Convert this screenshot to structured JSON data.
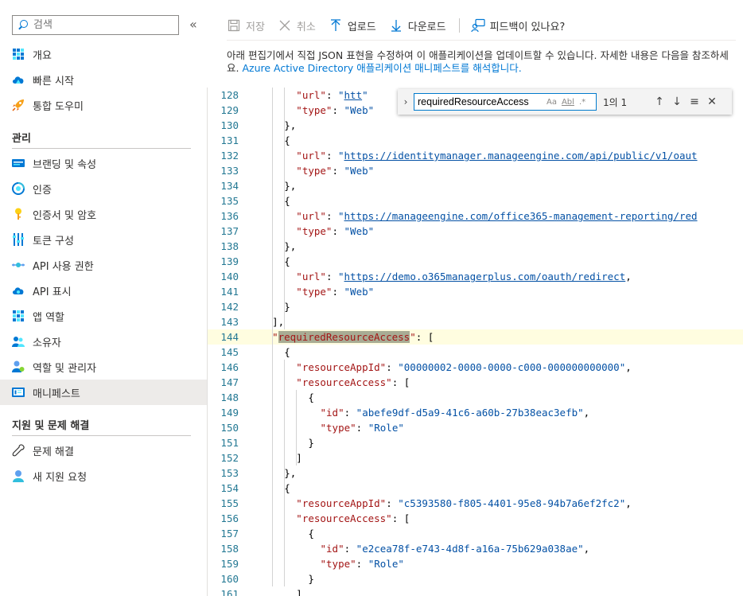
{
  "sidebar": {
    "search_placeholder": "검색",
    "collapse_glyph": "«",
    "items_top": [
      {
        "label": "개요",
        "icon": "grid-icon"
      },
      {
        "label": "빠른 시작",
        "icon": "cloud-icon"
      },
      {
        "label": "통합 도우미",
        "icon": "rocket-icon"
      }
    ],
    "section_manage": "관리",
    "items_manage": [
      {
        "label": "브랜딩 및 속성",
        "icon": "branding-icon"
      },
      {
        "label": "인증",
        "icon": "auth-icon"
      },
      {
        "label": "인증서 및 암호",
        "icon": "key-icon"
      },
      {
        "label": "토큰 구성",
        "icon": "token-icon"
      },
      {
        "label": "API 사용 권한",
        "icon": "api-permission-icon"
      },
      {
        "label": "API 표시",
        "icon": "api-cloud-icon"
      },
      {
        "label": "앱 역할",
        "icon": "app-roles-icon"
      },
      {
        "label": "소유자",
        "icon": "owners-icon"
      },
      {
        "label": "역할 및 관리자",
        "icon": "roles-admins-icon"
      },
      {
        "label": "매니페스트",
        "icon": "manifest-icon",
        "active": true
      }
    ],
    "section_support": "지원 및 문제 해결",
    "items_support": [
      {
        "label": "문제 해결",
        "icon": "wrench-icon"
      },
      {
        "label": "새 지원 요청",
        "icon": "support-icon"
      }
    ]
  },
  "toolbar": {
    "save": "저장",
    "discard": "취소",
    "upload": "업로드",
    "download": "다운로드",
    "feedback": "피드백이 있나요?"
  },
  "description": {
    "text": "아래 편집기에서 직접 JSON 표현을 수정하여 이 애플리케이션을 업데이트할 수 있습니다. 자세한 내용은 다음을 참조하세요.",
    "link": "Azure Active Directory 애플리케이션 매니페스트를 해석합니다."
  },
  "find": {
    "query": "requiredResourceAccess",
    "match_case": "Aa",
    "whole_word": "Abl",
    "regex": ".*",
    "count": "1의 1"
  },
  "editor": {
    "lines": [
      {
        "n": "128",
        "indent": 6,
        "key": "url",
        "val": "htt",
        "url": true,
        "tail": ""
      },
      {
        "n": "129",
        "indent": 6,
        "key": "type",
        "val": "Web",
        "tail": ""
      },
      {
        "n": "130",
        "indent": 4,
        "raw": "},"
      },
      {
        "n": "131",
        "indent": 4,
        "raw": "{"
      },
      {
        "n": "132",
        "indent": 6,
        "key": "url",
        "val": "https://identitymanager.manageengine.com/api/public/v1/oaut",
        "url": true,
        "tail": ""
      },
      {
        "n": "133",
        "indent": 6,
        "key": "type",
        "val": "Web",
        "tail": ""
      },
      {
        "n": "134",
        "indent": 4,
        "raw": "},"
      },
      {
        "n": "135",
        "indent": 4,
        "raw": "{"
      },
      {
        "n": "136",
        "indent": 6,
        "key": "url",
        "val": "https://manageengine.com/office365-management-reporting/red",
        "url": true,
        "tail": ""
      },
      {
        "n": "137",
        "indent": 6,
        "key": "type",
        "val": "Web",
        "tail": ""
      },
      {
        "n": "138",
        "indent": 4,
        "raw": "},"
      },
      {
        "n": "139",
        "indent": 4,
        "raw": "{"
      },
      {
        "n": "140",
        "indent": 6,
        "key": "url",
        "val": "https://demo.o365managerplus.com/oauth/redirect",
        "url": true,
        "tail": ","
      },
      {
        "n": "141",
        "indent": 6,
        "key": "type",
        "val": "Web",
        "tail": ""
      },
      {
        "n": "142",
        "indent": 4,
        "raw": "}"
      },
      {
        "n": "143",
        "indent": 2,
        "raw": "],"
      },
      {
        "n": "144",
        "indent": 2,
        "key": "requiredResourceAccess",
        "after": ": [",
        "current": true,
        "highlight": true
      },
      {
        "n": "145",
        "indent": 4,
        "raw": "{"
      },
      {
        "n": "146",
        "indent": 6,
        "key": "resourceAppId",
        "val": "00000002-0000-0000-c000-000000000000",
        "tail": ","
      },
      {
        "n": "147",
        "indent": 6,
        "key": "resourceAccess",
        "after": ": ["
      },
      {
        "n": "148",
        "indent": 8,
        "raw": "{"
      },
      {
        "n": "149",
        "indent": 10,
        "key": "id",
        "val": "abefe9df-d5a9-41c6-a60b-27b38eac3efb",
        "tail": ","
      },
      {
        "n": "150",
        "indent": 10,
        "key": "type",
        "val": "Role",
        "tail": ""
      },
      {
        "n": "151",
        "indent": 8,
        "raw": "}"
      },
      {
        "n": "152",
        "indent": 6,
        "raw": "]"
      },
      {
        "n": "153",
        "indent": 4,
        "raw": "},"
      },
      {
        "n": "154",
        "indent": 4,
        "raw": "{"
      },
      {
        "n": "155",
        "indent": 6,
        "key": "resourceAppId",
        "val": "c5393580-f805-4401-95e8-94b7a6ef2fc2",
        "tail": ","
      },
      {
        "n": "156",
        "indent": 6,
        "key": "resourceAccess",
        "after": ": ["
      },
      {
        "n": "157",
        "indent": 8,
        "raw": "{"
      },
      {
        "n": "158",
        "indent": 10,
        "key": "id",
        "val": "e2cea78f-e743-4d8f-a16a-75b629a038ae",
        "tail": ","
      },
      {
        "n": "159",
        "indent": 10,
        "key": "type",
        "val": "Role",
        "tail": ""
      },
      {
        "n": "160",
        "indent": 8,
        "raw": "}"
      },
      {
        "n": "161",
        "indent": 6,
        "raw": "]"
      }
    ]
  }
}
